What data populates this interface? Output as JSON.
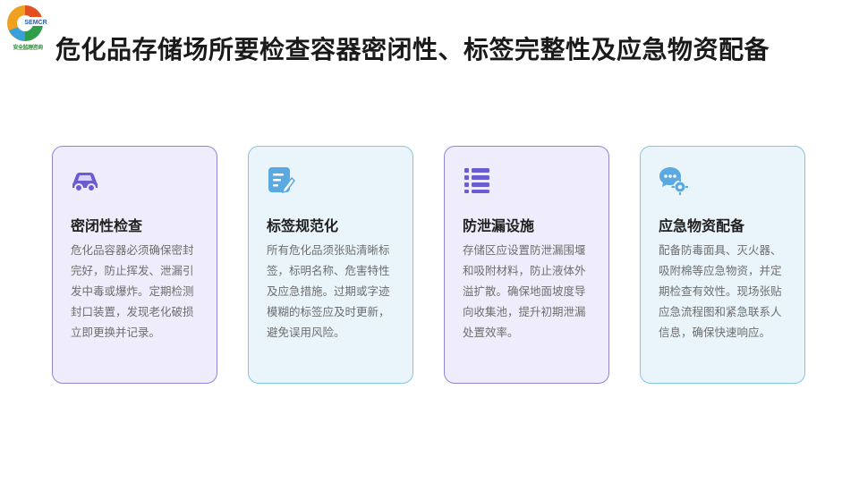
{
  "header": {
    "logo_name": "SEMCR logo",
    "logo_caption": "安全监理咨询",
    "title": "危化品存储场所要检查容器密闭性、标签完整性及应急物资配备"
  },
  "cards": [
    {
      "icon": "car-icon",
      "heading": "密闭性检查",
      "body": "危化品容器必须确保密封完好，防止挥发、泄漏引发中毒或爆炸。定期检测封口装置，发现老化破损立即更换并记录。"
    },
    {
      "icon": "edit-document-icon",
      "heading": "标签规范化",
      "body": "所有危化品须张贴清晰标签，标明名称、危害特性及应急措施。过期或字迹模糊的标签应及时更新，避免误用风险。"
    },
    {
      "icon": "list-icon",
      "heading": "防泄漏设施",
      "body": "存储区应设置防泄漏围堰和吸附材料，防止液体外溢扩散。确保地面坡度导向收集池，提升初期泄漏处置效率。"
    },
    {
      "icon": "chat-settings-icon",
      "heading": "应急物资配备",
      "body": "配备防毒面具、灭火器、吸附棉等应急物资，并定期检查有效性。现场张贴应急流程图和紧急联系人信息，确保快速响应。"
    }
  ],
  "colors": {
    "purple_card_bg": "#efedfb",
    "purple_card_border": "#8f86d6",
    "blue_card_bg": "#e9f5fb",
    "blue_card_border": "#86c6de",
    "icon_purple": "#6a5cd1",
    "icon_blue": "#5aa9e0"
  }
}
